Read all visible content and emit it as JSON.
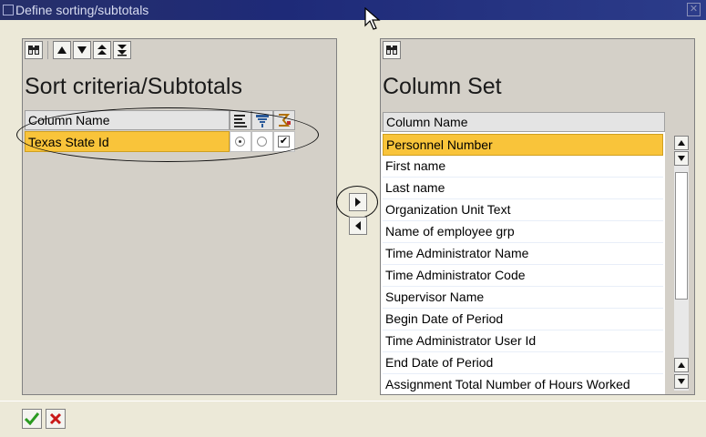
{
  "window": {
    "title": "Define sorting/subtotals",
    "title_color": "#1e2a78"
  },
  "sort_panel": {
    "title": "Sort criteria/Subtotals",
    "columns": {
      "name": "Column Name"
    },
    "rows": [
      {
        "name": "Texas State Id",
        "ascending": true,
        "descending": false,
        "subtotal": true
      }
    ]
  },
  "column_set": {
    "title": "Column Set",
    "header": "Column Name",
    "items": [
      "Personnel Number",
      "First name",
      "Last name",
      "Organization Unit Text",
      "Name of employee grp",
      "Time Administrator Name",
      "Time Administrator Code",
      "Supervisor Name",
      "Begin Date of Period",
      "Time Administrator User Id",
      "End Date of Period",
      "Assignment Total Number of Hours Worked"
    ],
    "selected_index": 0
  },
  "colors": {
    "selection": "#f9c43a",
    "panel": "#d4d0c8",
    "background": "#ece9d8",
    "ok": "#2a9a20",
    "cancel": "#c81818"
  }
}
